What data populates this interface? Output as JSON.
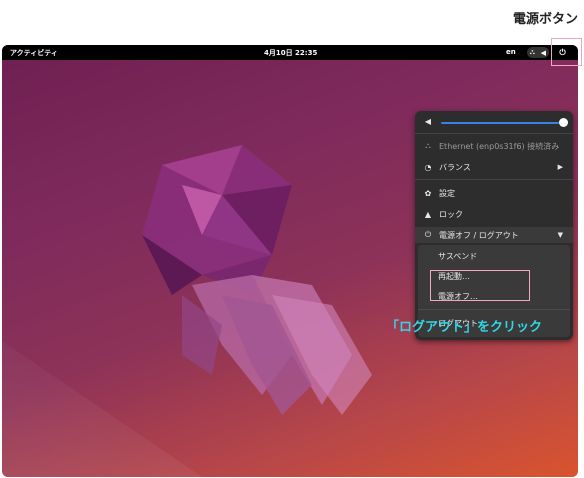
{
  "annotations": {
    "power_button_caption": "電源ボタン",
    "click_instruction": "「ログアウト」をクリック"
  },
  "topbar": {
    "activities_label": "アクティビティ",
    "clock": "4月10日  22:35",
    "input_method": "en",
    "icons": [
      "network-icon",
      "volume-icon",
      "power-icon"
    ]
  },
  "system_menu": {
    "volume_level": 1.0,
    "ethernet_label": "Ethernet (enp0s31f6) 接続済み",
    "balance_label": "バランス",
    "settings_label": "設定",
    "lock_label": "ロック",
    "power_section_label": "電源オフ / ログアウト",
    "power_submenu": {
      "suspend_label": "サスペンド",
      "restart_label": "再起動…",
      "poweroff_label": "電源オフ…",
      "logout_label": "ログアウト"
    }
  },
  "colors": {
    "accent": "#3584e4",
    "highlight": "#f4a6c9",
    "instruction_text": "#33d6e6"
  }
}
